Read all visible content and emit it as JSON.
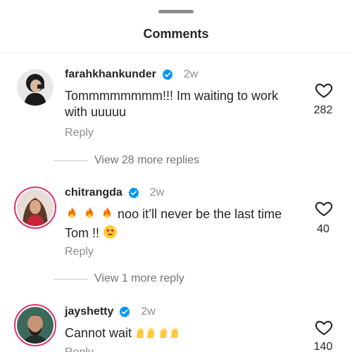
{
  "header": {
    "title": "Comments"
  },
  "comments": [
    {
      "username": "farahkhankunder",
      "time": "2w",
      "text": "Tommmmmmmm!!! Im waiting to work with uuuuu",
      "reply_label": "Reply",
      "like_count": "282",
      "view_more": "View 28 more replies"
    },
    {
      "username": "chitrangda",
      "time": "2w",
      "text_main": "noo it’ll never be the last time",
      "text_line2": "Tom !!",
      "reply_label": "Reply",
      "like_count": "40",
      "view_more": "View 1 more reply"
    },
    {
      "username": "jayshetty",
      "time": "2w",
      "text": "Cannot wait",
      "reply_label": "Reply",
      "like_count": "140"
    }
  ],
  "icons": {
    "verified": "verified-badge-icon",
    "like": "heart-icon",
    "fire": "fire-emoji",
    "heart_eyes": "heart-eyes-emoji",
    "raised_hands": "raised-hands-emoji"
  },
  "colors": {
    "verified_blue": "#0095f6",
    "muted_text": "#8e8e8e",
    "story_ring": "#e1306c"
  }
}
